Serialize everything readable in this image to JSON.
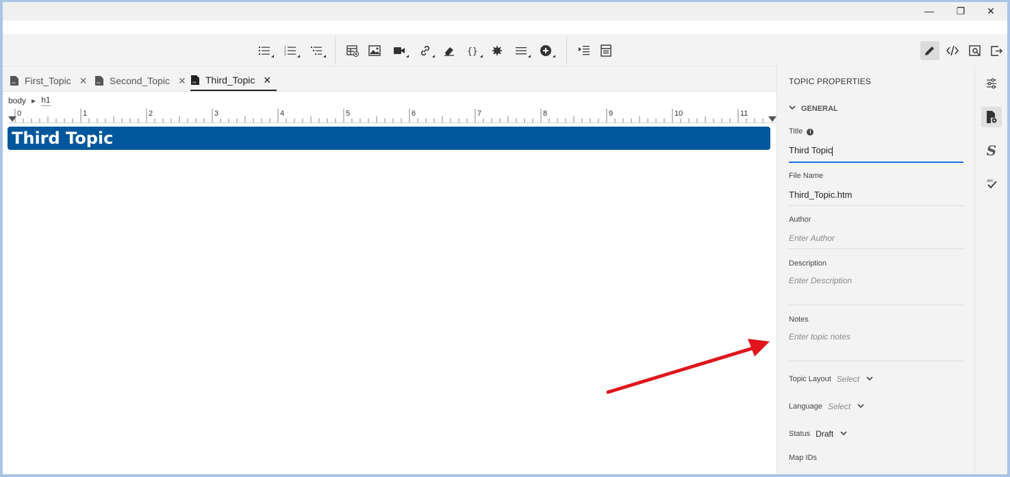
{
  "window": {
    "minimize": "—",
    "restore": "❐",
    "close": "✕"
  },
  "tabs": [
    {
      "label": "First_Topic",
      "close": "✕"
    },
    {
      "label": "Second_Topic",
      "close": "✕"
    },
    {
      "label": "Third_Topic",
      "close": "✕"
    }
  ],
  "breadcrumb": {
    "body": "body",
    "element": "h1"
  },
  "ruler": {
    "labels": [
      "0",
      "1",
      "2",
      "3",
      "4",
      "5",
      "6",
      "7",
      "8",
      "9",
      "10",
      "11"
    ]
  },
  "editor": {
    "heading": "Third Topic"
  },
  "properties": {
    "panel_title": "TOPIC PROPERTIES",
    "section": "GENERAL",
    "title_label": "Title",
    "title_value": "Third Topic",
    "filename_label": "File Name",
    "filename_value": "Third_Topic.htm",
    "author_label": "Author",
    "author_placeholder": "Enter Author",
    "description_label": "Description",
    "description_placeholder": "Enter Description",
    "notes_label": "Notes",
    "notes_placeholder": "Enter topic notes",
    "layout_label": "Topic Layout",
    "layout_value": "Select",
    "language_label": "Language",
    "language_value": "Select",
    "status_label": "Status",
    "status_value": "Draft",
    "mapids_label": "Map IDs"
  },
  "toolbar_icons": [
    "bulleted-list-icon",
    "numbered-list-icon",
    "multilevel-list-icon",
    "insert-table-icon",
    "insert-image-icon",
    "insert-video-icon",
    "insert-link-icon",
    "eraser-icon",
    "variable-icon",
    "snippet-icon",
    "horizontal-rule-icon",
    "insert-plus-icon",
    "indent-icon",
    "page-break-icon",
    "edit-pencil-icon",
    "code-view-icon",
    "preview-icon",
    "export-icon"
  ],
  "colors": {
    "heading_bg": "#01579b",
    "arrow": "#e0161c",
    "focus_underline": "#1473e6"
  }
}
